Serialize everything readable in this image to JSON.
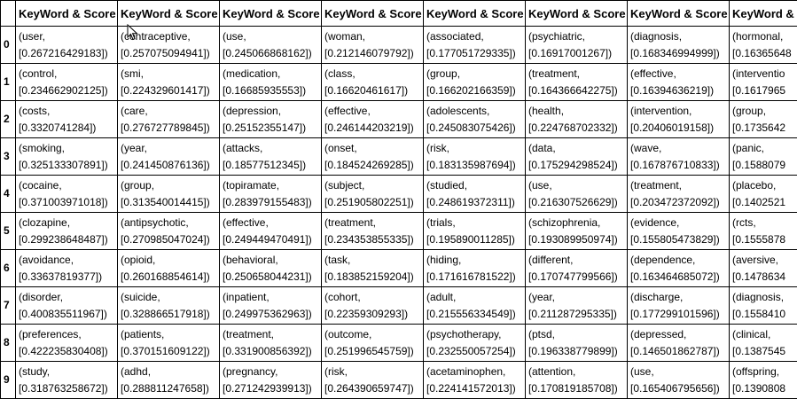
{
  "table": {
    "headers": [
      "KeyWord & Score",
      "KeyWord & Score",
      "KeyWord & Score",
      "KeyWord & Score",
      "KeyWord & Score",
      "KeyWord & Score",
      "KeyWord & Score",
      "KeyWord & Score"
    ],
    "rows": [
      {
        "index": "0",
        "cells": [
          [
            "(user,",
            "[0.267216429183])"
          ],
          [
            "(contraceptive,",
            "[0.257075094941])"
          ],
          [
            "(use,",
            "[0.245066868162])"
          ],
          [
            "(woman,",
            "[0.212146079792])"
          ],
          [
            "(associated,",
            "[0.177051729335])"
          ],
          [
            "(psychiatric,",
            "[0.16917001267])"
          ],
          [
            "(diagnosis,",
            "[0.168346994999])"
          ],
          [
            "(hormonal,",
            "[0.16365648"
          ]
        ]
      },
      {
        "index": "1",
        "cells": [
          [
            "(control,",
            "[0.234662902125])"
          ],
          [
            "(smi,",
            "[0.224329601417])"
          ],
          [
            "(medication,",
            "[0.16685935553])"
          ],
          [
            "(class,",
            "[0.16620461617])"
          ],
          [
            "(group,",
            "[0.166202166359])"
          ],
          [
            "(treatment,",
            "[0.164366642275])"
          ],
          [
            "(effective,",
            "[0.16394636219])"
          ],
          [
            "(interventio",
            "[0.1617965"
          ]
        ]
      },
      {
        "index": "2",
        "cells": [
          [
            "(costs,",
            "[0.3320741284])"
          ],
          [
            "(care,",
            "[0.276727789845])"
          ],
          [
            "(depression,",
            "[0.25152355147])"
          ],
          [
            "(effective,",
            "[0.246144203219])"
          ],
          [
            "(adolescents,",
            "[0.245083075426])"
          ],
          [
            "(health,",
            "[0.224768702332])"
          ],
          [
            "(intervention,",
            "[0.20406019158])"
          ],
          [
            "(group,",
            "[0.1735642"
          ]
        ]
      },
      {
        "index": "3",
        "cells": [
          [
            "(smoking,",
            "[0.325133307891])"
          ],
          [
            "(year,",
            "[0.241450876136])"
          ],
          [
            "(attacks,",
            "[0.18577512345])"
          ],
          [
            "(onset,",
            "[0.184524269285])"
          ],
          [
            "(risk,",
            "[0.183135987694])"
          ],
          [
            "(data,",
            "[0.175294298524])"
          ],
          [
            "(wave,",
            "[0.167876710833])"
          ],
          [
            "(panic,",
            "[0.1588079"
          ]
        ]
      },
      {
        "index": "4",
        "cells": [
          [
            "(cocaine,",
            "[0.371003971018])"
          ],
          [
            "(group,",
            "[0.313540014415])"
          ],
          [
            "(topiramate,",
            "[0.283979155483])"
          ],
          [
            "(subject,",
            "[0.251905802251])"
          ],
          [
            "(studied,",
            "[0.248619372311])"
          ],
          [
            "(use,",
            "[0.216307526629])"
          ],
          [
            "(treatment,",
            "[0.203472372092])"
          ],
          [
            "(placebo,",
            "[0.1402521"
          ]
        ]
      },
      {
        "index": "5",
        "cells": [
          [
            "(clozapine,",
            "[0.299238648487])"
          ],
          [
            "(antipsychotic,",
            "[0.270985047024])"
          ],
          [
            "(effective,",
            "[0.249449470491])"
          ],
          [
            "(treatment,",
            "[0.234353855335])"
          ],
          [
            "(trials,",
            "[0.195890011285])"
          ],
          [
            "(schizophrenia,",
            "[0.193089950974])"
          ],
          [
            "(evidence,",
            "[0.155805473829])"
          ],
          [
            "(rcts,",
            "[0.1555878"
          ]
        ]
      },
      {
        "index": "6",
        "cells": [
          [
            "(avoidance,",
            "[0.33637819377])"
          ],
          [
            "(opioid,",
            "[0.260168854614])"
          ],
          [
            "(behavioral,",
            "[0.250658044231])"
          ],
          [
            "(task,",
            "[0.183852159204])"
          ],
          [
            "(hiding,",
            "[0.171616781522])"
          ],
          [
            "(different,",
            "[0.170747799566])"
          ],
          [
            "(dependence,",
            "[0.163464685072])"
          ],
          [
            "(aversive,",
            "[0.1478634"
          ]
        ]
      },
      {
        "index": "7",
        "cells": [
          [
            "(disorder,",
            "[0.400835511967])"
          ],
          [
            "(suicide,",
            "[0.328866517918])"
          ],
          [
            "(inpatient,",
            "[0.249975362963])"
          ],
          [
            "(cohort,",
            "[0.22359309293])"
          ],
          [
            "(adult,",
            "[0.215556334549])"
          ],
          [
            "(year,",
            "[0.211287295335])"
          ],
          [
            "(discharge,",
            "[0.177299101596])"
          ],
          [
            "(diagnosis,",
            "[0.1558410"
          ]
        ]
      },
      {
        "index": "8",
        "cells": [
          [
            "(preferences,",
            "[0.422235830408])"
          ],
          [
            "(patients,",
            "[0.370151609122])"
          ],
          [
            "(treatment,",
            "[0.331900856392])"
          ],
          [
            "(outcome,",
            "[0.251996545759])"
          ],
          [
            "(psychotherapy,",
            "[0.232550057254])"
          ],
          [
            "(ptsd,",
            "[0.196338779899])"
          ],
          [
            "(depressed,",
            "[0.146501862787])"
          ],
          [
            "(clinical,",
            "[0.1387545"
          ]
        ]
      },
      {
        "index": "9",
        "cells": [
          [
            "(study,",
            "[0.318763258672])"
          ],
          [
            "(adhd,",
            "[0.288811247658])"
          ],
          [
            "(pregnancy,",
            "[0.271242939913])"
          ],
          [
            "(risk,",
            "[0.264390659747])"
          ],
          [
            "(acetaminophen,",
            "[0.224141572013])"
          ],
          [
            "(attention,",
            "[0.170819185708])"
          ],
          [
            "(use,",
            "[0.165406795656])"
          ],
          [
            "(offspring,",
            "[0.1390808"
          ]
        ]
      }
    ]
  }
}
